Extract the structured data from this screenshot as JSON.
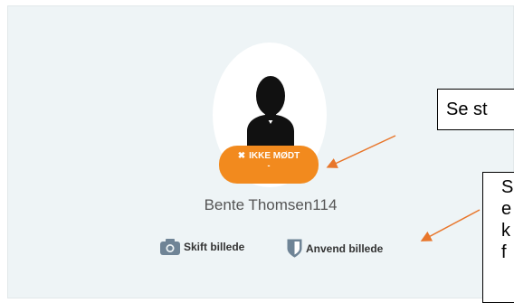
{
  "profile": {
    "status_badge": "IKKE MØDT",
    "status_sub": "-",
    "name": "Bente Thomsen114"
  },
  "actions": {
    "change_photo": "Skift billede",
    "apply_photo": "Anvend billede"
  },
  "annotations": {
    "callout_1": "Se st",
    "callout_2_lines": [
      "S",
      "e",
      "k",
      "f"
    ]
  },
  "colors": {
    "accent": "#f28a1e",
    "card_bg": "#eef4f6",
    "icon": "#6f8496"
  }
}
